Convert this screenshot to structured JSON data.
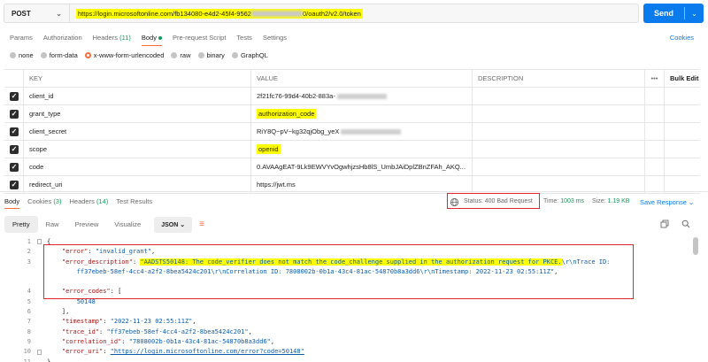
{
  "request": {
    "method": "POST",
    "url_highlighted_prefix": "https://login.microsoftonline.com/fb134080-e4d2-45f4-9562",
    "url_highlighted_suffix": "0/oauth2/v2.0/token",
    "send_label": "Send"
  },
  "request_tabs": [
    {
      "label": "Params",
      "active": false
    },
    {
      "label": "Authorization",
      "active": false
    },
    {
      "label": "Headers",
      "count": "(11)",
      "active": false
    },
    {
      "label": "Body",
      "active": true
    },
    {
      "label": "Pre-request Script",
      "active": false
    },
    {
      "label": "Tests",
      "active": false
    },
    {
      "label": "Settings",
      "active": false
    }
  ],
  "cookies_label": "Cookies",
  "body_types": [
    {
      "label": "none",
      "selected": false
    },
    {
      "label": "form-data",
      "selected": false
    },
    {
      "label": "x-www-form-urlencoded",
      "selected": true
    },
    {
      "label": "raw",
      "selected": false
    },
    {
      "label": "binary",
      "selected": false
    },
    {
      "label": "GraphQL",
      "selected": false
    }
  ],
  "params_table": {
    "headers": {
      "key": "KEY",
      "value": "VALUE",
      "description": "DESCRIPTION",
      "more": "•••",
      "bulk_edit": "Bulk Edit"
    },
    "rows": [
      {
        "key": "client_id",
        "value": "2f21fc76-99d4-40b2-883a-",
        "highlight": false
      },
      {
        "key": "grant_type",
        "value": "authorization_code",
        "highlight": true
      },
      {
        "key": "client_secret",
        "value": "RiY8Q~pV~kg32qjObg_yeX",
        "highlight": false
      },
      {
        "key": "scope",
        "value": "openid",
        "highlight": true
      },
      {
        "key": "code",
        "value": "0.AVAAgEAT-9Lk9EWVYvOgwhjzsHb8lS_UmbJAiDplZBnZFAh_AKQ...",
        "highlight": false
      },
      {
        "key": "redirect_uri",
        "value": "https://jwt.ms",
        "highlight": false
      }
    ]
  },
  "response_tabs": [
    {
      "label": "Body",
      "active": true
    },
    {
      "label": "Cookies",
      "count": "(3)",
      "active": false
    },
    {
      "label": "Headers",
      "count": "(14)",
      "active": false
    },
    {
      "label": "Test Results",
      "active": false
    }
  ],
  "response_meta": {
    "status_label": "Status:",
    "status_value": "400 Bad Request",
    "time_label": "Time:",
    "time_value": "1003 ms",
    "size_label": "Size:",
    "size_value": "1.19 KB",
    "save_label": "Save Response"
  },
  "view_modes": [
    "Pretty",
    "Raw",
    "Preview",
    "Visualize"
  ],
  "format": "JSON",
  "code": {
    "line_numbers": [
      "1",
      "2",
      "3",
      "",
      "",
      "4",
      "5",
      "6",
      "7",
      "8",
      "9",
      "10",
      "11"
    ],
    "error_key": "\"error\"",
    "error_val": "\"invalid_grant\"",
    "desc_key": "\"error_description\"",
    "desc_val_hl": "\"AADSTS50148: The code_verifier does not match the code_challenge supplied in the authorization request for PKCE.",
    "desc_val_rest": "\\r\\nTrace ID:",
    "desc_cont1": "ff37ebeb-58ef-4cc4-a2f2-8bea5424c201\\r\\nCorrelation ID: 7808002b-0b1a-43c4-81ac-54870b8a3dd6\\r\\nTimestamp: 2022-11-23 02:55:11Z\"",
    "codes_key": "\"error_codes\"",
    "codes_val": "50148",
    "timestamp_key": "\"timestamp\"",
    "timestamp_val": "\"2022-11-23 02:55:11Z\"",
    "trace_key": "\"trace_id\"",
    "trace_val": "\"ff37ebeb-58ef-4cc4-a2f2-8bea5424c201\"",
    "corr_key": "\"correlation_id\"",
    "corr_val": "\"7808002b-0b1a-43c4-81ac-54870b8a3dd6\"",
    "uri_key": "\"error_uri\"",
    "uri_val": "\"https://login.microsoftonline.com/error?code=50148\""
  },
  "colors": {
    "accent": "#ff6c37",
    "send": "#097bed",
    "highlight": "#ffff00",
    "annotation": "#e3262e"
  }
}
